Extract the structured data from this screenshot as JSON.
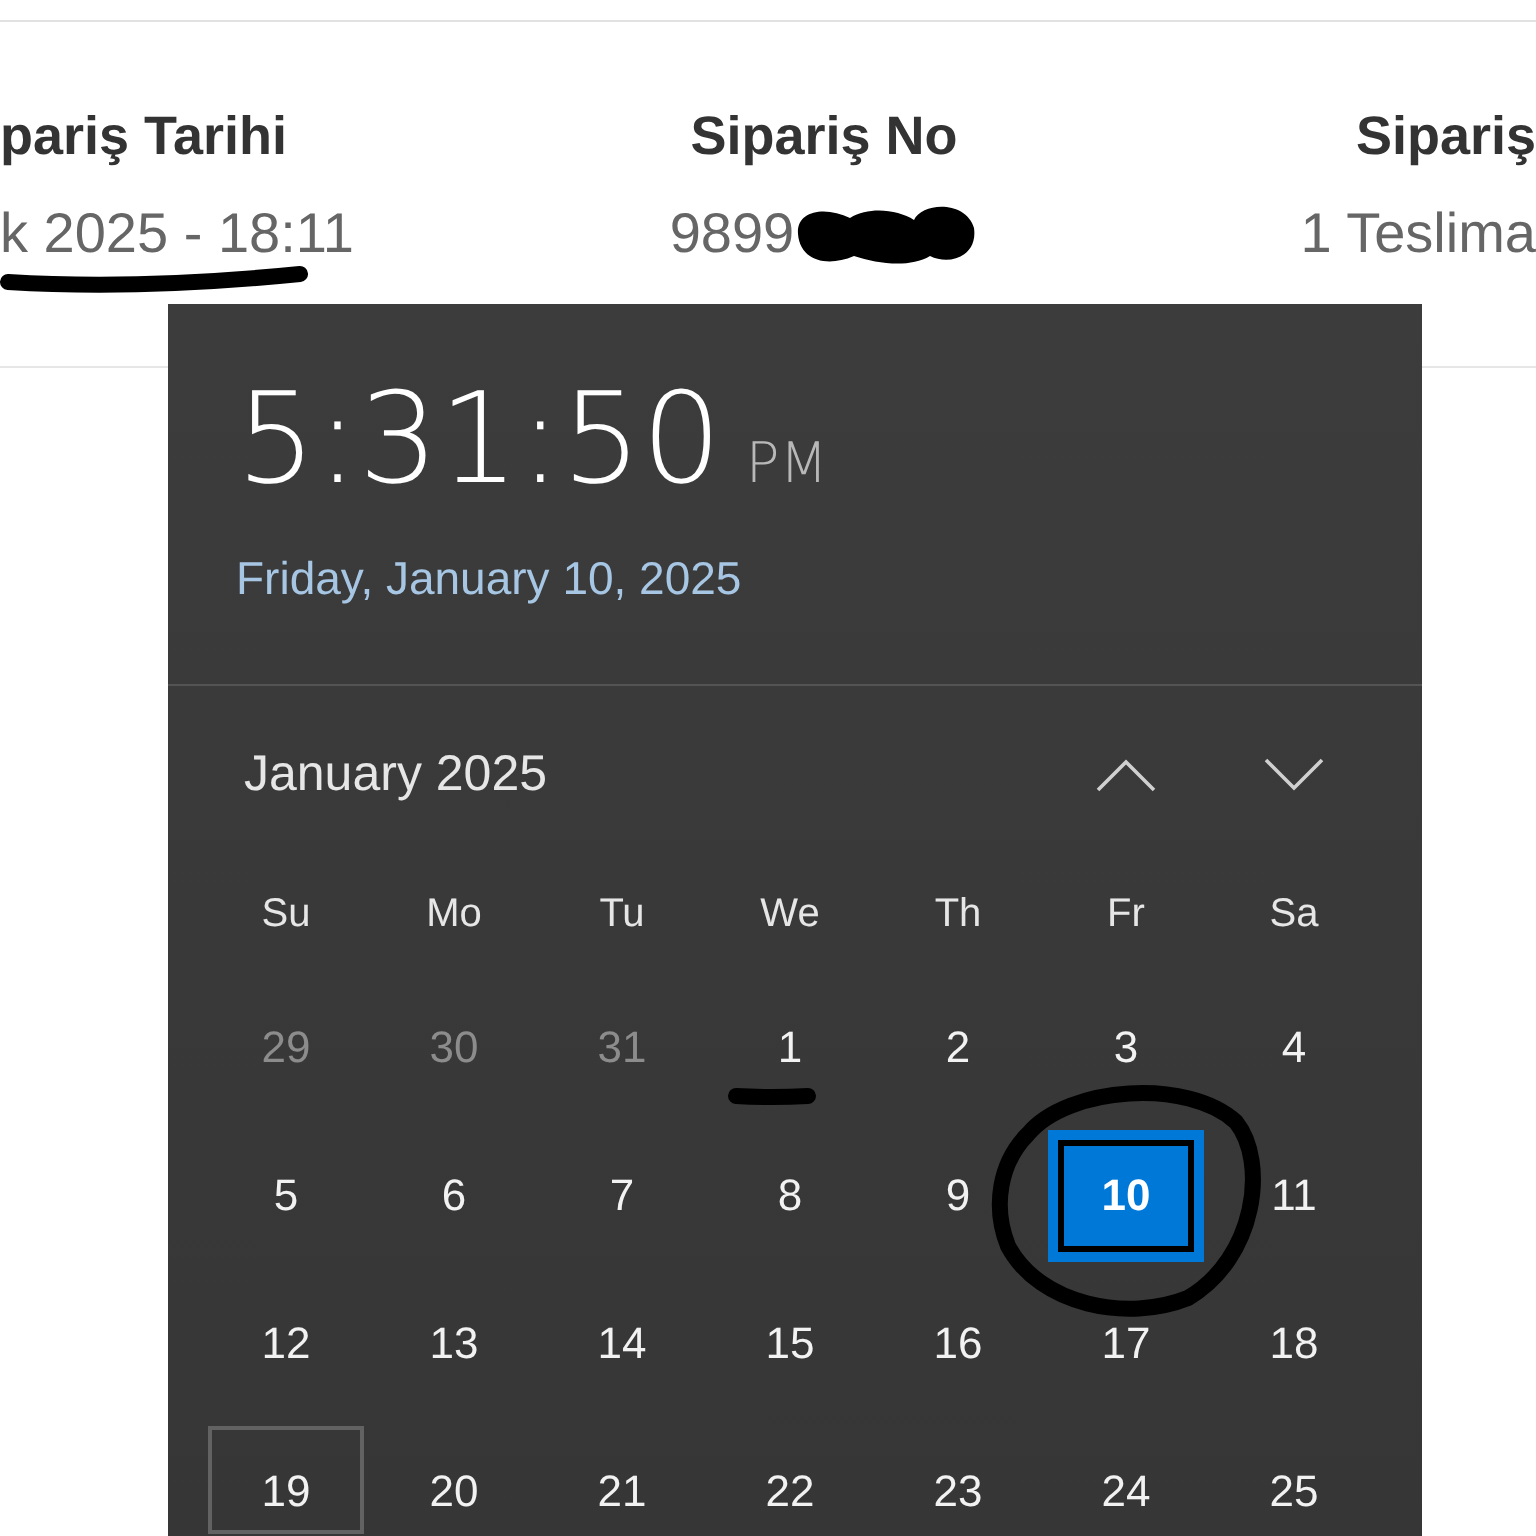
{
  "order_summary": {
    "columns": [
      {
        "heading": "pariş Tarihi",
        "value": "k 2025 - 18:11",
        "underlined": true,
        "redacted": false
      },
      {
        "heading": "Sipariş No",
        "value": "9899",
        "underlined": false,
        "redacted": true
      },
      {
        "heading": "Sipariş",
        "value": "1 Teslima",
        "underlined": false,
        "redacted": false
      }
    ]
  },
  "clock_flyout": {
    "time": "5:31:50",
    "period": "PM",
    "date": "Friday, January 10, 2025",
    "month": "January 2025",
    "weekdays": [
      "Su",
      "Mo",
      "Tu",
      "We",
      "Th",
      "Fr",
      "Sa"
    ],
    "days": [
      {
        "label": "29",
        "outside_month": true,
        "selected": false,
        "hovered": false,
        "underlined": false,
        "circled": false
      },
      {
        "label": "30",
        "outside_month": true,
        "selected": false,
        "hovered": false,
        "underlined": false,
        "circled": false
      },
      {
        "label": "31",
        "outside_month": true,
        "selected": false,
        "hovered": false,
        "underlined": false,
        "circled": false
      },
      {
        "label": "1",
        "outside_month": false,
        "selected": false,
        "hovered": false,
        "underlined": true,
        "circled": false
      },
      {
        "label": "2",
        "outside_month": false,
        "selected": false,
        "hovered": false,
        "underlined": false,
        "circled": false
      },
      {
        "label": "3",
        "outside_month": false,
        "selected": false,
        "hovered": false,
        "underlined": false,
        "circled": false
      },
      {
        "label": "4",
        "outside_month": false,
        "selected": false,
        "hovered": false,
        "underlined": false,
        "circled": false
      },
      {
        "label": "5",
        "outside_month": false,
        "selected": false,
        "hovered": false,
        "underlined": false,
        "circled": false
      },
      {
        "label": "6",
        "outside_month": false,
        "selected": false,
        "hovered": false,
        "underlined": false,
        "circled": false
      },
      {
        "label": "7",
        "outside_month": false,
        "selected": false,
        "hovered": false,
        "underlined": false,
        "circled": false
      },
      {
        "label": "8",
        "outside_month": false,
        "selected": false,
        "hovered": false,
        "underlined": false,
        "circled": false
      },
      {
        "label": "9",
        "outside_month": false,
        "selected": false,
        "hovered": false,
        "underlined": false,
        "circled": false
      },
      {
        "label": "10",
        "outside_month": false,
        "selected": true,
        "hovered": false,
        "underlined": false,
        "circled": true
      },
      {
        "label": "11",
        "outside_month": false,
        "selected": false,
        "hovered": false,
        "underlined": false,
        "circled": false
      },
      {
        "label": "12",
        "outside_month": false,
        "selected": false,
        "hovered": false,
        "underlined": false,
        "circled": false
      },
      {
        "label": "13",
        "outside_month": false,
        "selected": false,
        "hovered": false,
        "underlined": false,
        "circled": false
      },
      {
        "label": "14",
        "outside_month": false,
        "selected": false,
        "hovered": false,
        "underlined": false,
        "circled": false
      },
      {
        "label": "15",
        "outside_month": false,
        "selected": false,
        "hovered": false,
        "underlined": false,
        "circled": false
      },
      {
        "label": "16",
        "outside_month": false,
        "selected": false,
        "hovered": false,
        "underlined": false,
        "circled": false
      },
      {
        "label": "17",
        "outside_month": false,
        "selected": false,
        "hovered": false,
        "underlined": false,
        "circled": false
      },
      {
        "label": "18",
        "outside_month": false,
        "selected": false,
        "hovered": false,
        "underlined": false,
        "circled": false
      },
      {
        "label": "19",
        "outside_month": false,
        "selected": false,
        "hovered": true,
        "underlined": false,
        "circled": false
      },
      {
        "label": "20",
        "outside_month": false,
        "selected": false,
        "hovered": false,
        "underlined": false,
        "circled": false
      },
      {
        "label": "21",
        "outside_month": false,
        "selected": false,
        "hovered": false,
        "underlined": false,
        "circled": false
      },
      {
        "label": "22",
        "outside_month": false,
        "selected": false,
        "hovered": false,
        "underlined": false,
        "circled": false
      },
      {
        "label": "23",
        "outside_month": false,
        "selected": false,
        "hovered": false,
        "underlined": false,
        "circled": false
      },
      {
        "label": "24",
        "outside_month": false,
        "selected": false,
        "hovered": false,
        "underlined": false,
        "circled": false
      },
      {
        "label": "25",
        "outside_month": false,
        "selected": false,
        "hovered": false,
        "underlined": false,
        "circled": false
      }
    ]
  }
}
